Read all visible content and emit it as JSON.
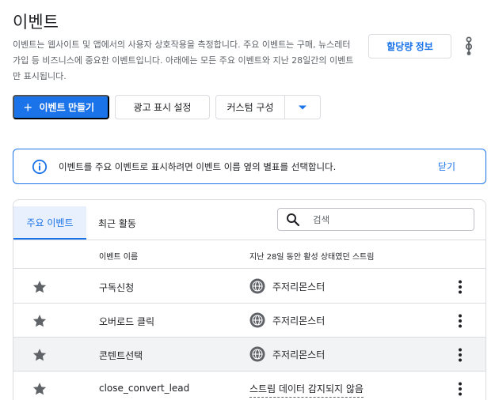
{
  "header": {
    "title": "이벤트",
    "description": "이벤트는 웹사이트 및 앱에서의 사용자 상호작용을 측정합니다. 주요 이벤트는 구매, 뉴스레터 가입 등 비즈니스에 중요한 이벤트입니다. 아래에는 모든 주요 이벤트와 지난 28일간의 이벤트만 표시됩니다.",
    "quota_label": "할당량 정보"
  },
  "toolbar": {
    "create_label": "이벤트 만들기",
    "ad_settings_label": "광고 표시 설정",
    "custom_label": "커스텀 구성"
  },
  "banner": {
    "message": "이벤트를 주요 이벤트로 표시하려면 이벤트 이름 옆의 별표를 선택합니다.",
    "close_label": "닫기"
  },
  "tabs": [
    {
      "label": "주요 이벤트",
      "active": true
    },
    {
      "label": "최근 활동",
      "active": false
    }
  ],
  "search": {
    "placeholder": "검색"
  },
  "table": {
    "columns": [
      "이벤트 이름",
      "지난 28일 동안 활성 상태였던 스트림"
    ],
    "rows": [
      {
        "name": "구독신청",
        "stream": "주저리몬스터"
      },
      {
        "name": "오버로드 클릭",
        "stream": "주저리몬스터"
      },
      {
        "name": "콘텐트선택",
        "stream": "주저리몬스터"
      },
      {
        "name": "close_convert_lead",
        "stream": "스트림 데이터 감지되지 않음"
      }
    ]
  },
  "colors": {
    "accent": "#1a73e8",
    "icon_gray": "#5f6368",
    "highlight_row": "#f1f3f4"
  }
}
